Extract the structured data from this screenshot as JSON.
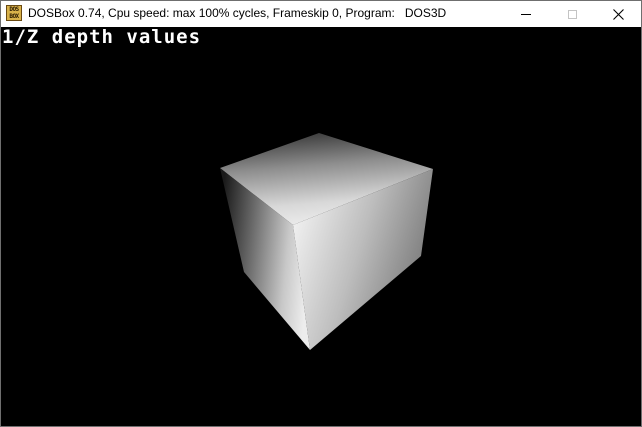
{
  "window": {
    "title": "DOSBox 0.74, Cpu speed: max 100% cycles, Frameskip  0, Program:",
    "program": "DOS3D",
    "icon": "dosbox-icon",
    "icon_text": "DOS\nBOX"
  },
  "controls": {
    "minimize": "minimize-icon",
    "maximize": "maximize-icon",
    "close": "close-icon"
  },
  "screen": {
    "label": "1/Z depth values",
    "background": "#000000",
    "text_color": "#ffffff"
  }
}
